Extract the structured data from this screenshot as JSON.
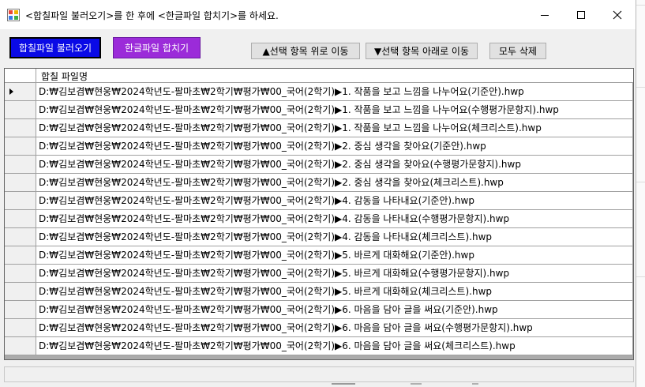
{
  "window": {
    "title": "<합칠파일 불러오기>를 한 후에 <한글파일 합치기>를 하세요.",
    "controls": {
      "minimize": "minimize",
      "maximize": "maximize",
      "close": "close"
    }
  },
  "toolbar": {
    "load_label": "합칠파일 불러오기",
    "merge_label": "한글파일 합치기",
    "move_up_label": "▲선택 항목 위로 이동",
    "move_down_label": "▼선택 항목 아래로 이동",
    "delete_all_label": "모두 삭제"
  },
  "colors": {
    "load_button": "#0a0ae6",
    "merge_button": "#9b2bd9"
  },
  "grid": {
    "column_header": "합칠 파일명",
    "selected_index": 0,
    "rows": [
      "D:₩김보겸₩현웅₩2024학년도-팔마초₩2학기₩평가₩00_국어(2학기)▶1. 작품을 보고 느낌을 나누어요(기준안).hwp",
      "D:₩김보겸₩현웅₩2024학년도-팔마초₩2학기₩평가₩00_국어(2학기)▶1. 작품을 보고 느낌을 나누어요(수행평가문항지).hwp",
      "D:₩김보겸₩현웅₩2024학년도-팔마초₩2학기₩평가₩00_국어(2학기)▶1. 작품을 보고 느낌을 나누어요(체크리스트).hwp",
      "D:₩김보겸₩현웅₩2024학년도-팔마초₩2학기₩평가₩00_국어(2학기)▶2. 중심 생각을 찾아요(기준안).hwp",
      "D:₩김보겸₩현웅₩2024학년도-팔마초₩2학기₩평가₩00_국어(2학기)▶2. 중심 생각을 찾아요(수행평가문항지).hwp",
      "D:₩김보겸₩현웅₩2024학년도-팔마초₩2학기₩평가₩00_국어(2학기)▶2. 중심 생각을 찾아요(체크리스트).hwp",
      "D:₩김보겸₩현웅₩2024학년도-팔마초₩2학기₩평가₩00_국어(2학기)▶4. 감동을 나타내요(기준안).hwp",
      "D:₩김보겸₩현웅₩2024학년도-팔마초₩2학기₩평가₩00_국어(2학기)▶4. 감동을 나타내요(수행평가문항지).hwp",
      "D:₩김보겸₩현웅₩2024학년도-팔마초₩2학기₩평가₩00_국어(2학기)▶4. 감동을 나타내요(체크리스트).hwp",
      "D:₩김보겸₩현웅₩2024학년도-팔마초₩2학기₩평가₩00_국어(2학기)▶5. 바르게 대화해요(기준안).hwp",
      "D:₩김보겸₩현웅₩2024학년도-팔마초₩2학기₩평가₩00_국어(2학기)▶5. 바르게 대화해요(수행평가문항지).hwp",
      "D:₩김보겸₩현웅₩2024학년도-팔마초₩2학기₩평가₩00_국어(2학기)▶5. 바르게 대화해요(체크리스트).hwp",
      "D:₩김보겸₩현웅₩2024학년도-팔마초₩2학기₩평가₩00_국어(2학기)▶6. 마음을 담아 글을 써요(기준안).hwp",
      "D:₩김보겸₩현웅₩2024학년도-팔마초₩2학기₩평가₩00_국어(2학기)▶6. 마음을 담아 글을 써요(수행평가문항지).hwp",
      "D:₩김보겸₩현웅₩2024학년도-팔마초₩2학기₩평가₩00_국어(2학기)▶6. 마음을 담아 글을 써요(체크리스트).hwp"
    ]
  },
  "status": {
    "text": ""
  }
}
